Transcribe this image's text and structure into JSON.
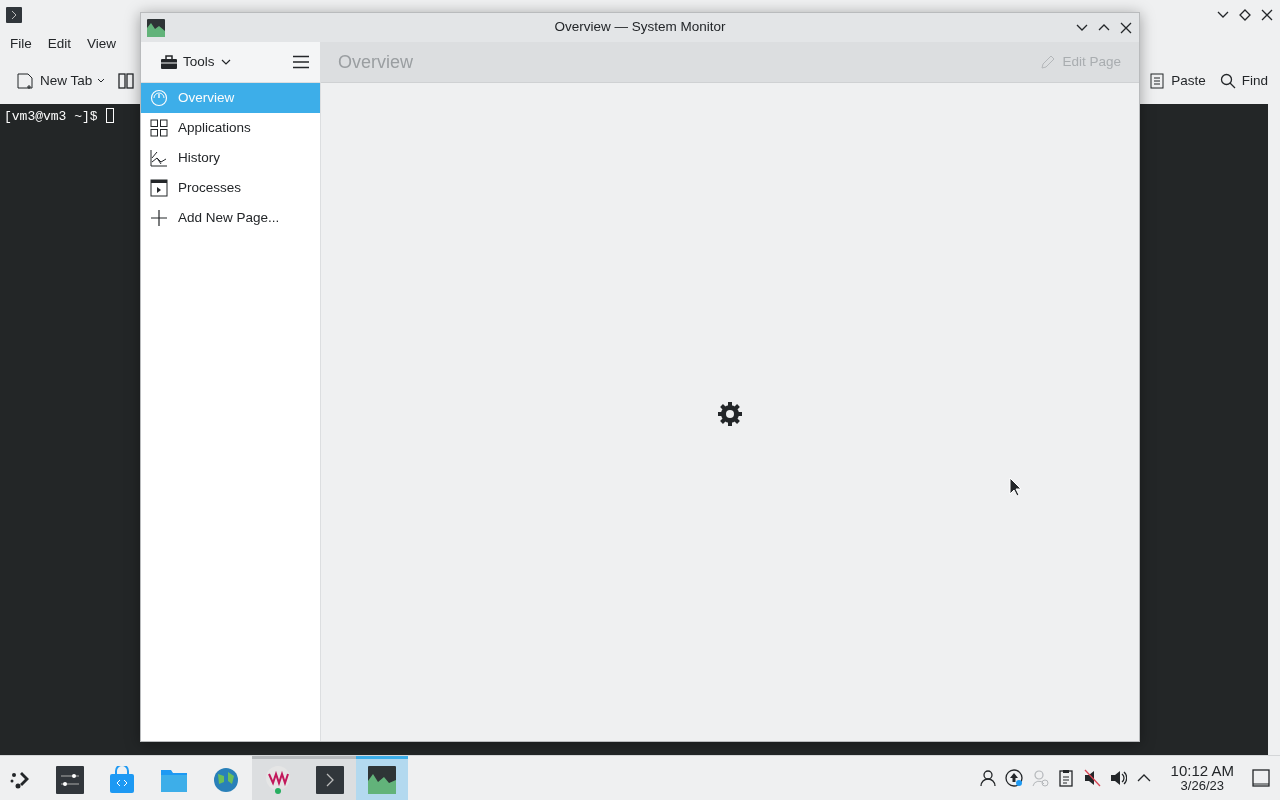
{
  "background_window": {
    "menu": [
      {
        "label": "File"
      },
      {
        "label": "Edit"
      },
      {
        "label": "View"
      }
    ],
    "toolbar": [
      {
        "label": "New Tab"
      },
      {
        "label": "Paste"
      },
      {
        "label": "Find"
      }
    ],
    "terminal": {
      "prompt": "[vm3@vm3 ~]$"
    }
  },
  "window": {
    "title": "Overview — System Monitor"
  },
  "sidebar": {
    "tools_label": "Tools",
    "items": [
      {
        "label": "Overview",
        "selected": true
      },
      {
        "label": "Applications",
        "selected": false
      },
      {
        "label": "History",
        "selected": false
      },
      {
        "label": "Processes",
        "selected": false
      },
      {
        "label": "Add New Page...",
        "selected": false
      }
    ]
  },
  "page_header": {
    "title": "Overview",
    "edit_button": {
      "label": "Edit Page",
      "disabled": true
    }
  },
  "taskbar": {
    "apps": [
      {
        "selected": false,
        "running": false
      },
      {
        "selected": false,
        "running": false
      },
      {
        "selected": false,
        "running": false
      },
      {
        "selected": false,
        "running": false
      },
      {
        "selected": false,
        "running": false
      },
      {
        "selected": false,
        "running": true
      },
      {
        "selected": false,
        "running": true
      },
      {
        "selected": true,
        "running": true
      }
    ],
    "clock": {
      "time": "10:12 AM",
      "date": "3/26/23"
    }
  }
}
